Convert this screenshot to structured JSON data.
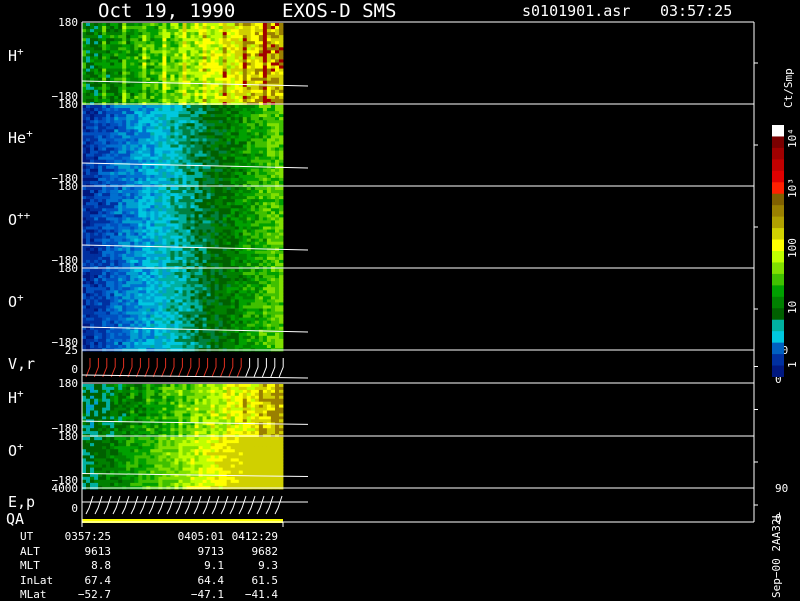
{
  "header": {
    "date": "Oct 19, 1990",
    "mission": "EXOS-D SMS",
    "file": "s0101901.asr",
    "time": "03:57:25"
  },
  "panels": [
    {
      "label": "H",
      "sup": "+",
      "ymax": "180",
      "ymin": "−180"
    },
    {
      "label": "He",
      "sup": "+",
      "ymax": "180",
      "ymin": "−180"
    },
    {
      "label": "O",
      "sup": "++",
      "ymax": "180",
      "ymin": "−180"
    },
    {
      "label": "O",
      "sup": "+",
      "ymax": "180",
      "ymin": "−180"
    },
    {
      "label": "V,r",
      "sup": "",
      "ymax": "25",
      "ymin": "0",
      "rmax": "90",
      "rmin": "0"
    },
    {
      "label": "H",
      "sup": "+",
      "ymax": "180",
      "ymin": "−180"
    },
    {
      "label": "O",
      "sup": "+",
      "ymax": "180",
      "ymin": "−180"
    },
    {
      "label": "E,p",
      "sup": "",
      "ymax": "4000",
      "ymin": "0",
      "rmax": "90",
      "rmin": "0"
    }
  ],
  "qa_label": "QA",
  "colorbar": {
    "unit": "Ct/Smp",
    "labels": [
      "10⁴",
      "10³",
      "100",
      "10",
      "1"
    ],
    "colors": [
      "#ffffff",
      "#7a0000",
      "#a00000",
      "#c00000",
      "#e00000",
      "#ff2000",
      "#806000",
      "#9a8000",
      "#b0a000",
      "#d0d000",
      "#ffff00",
      "#c0ff00",
      "#80e000",
      "#40c000",
      "#00a000",
      "#008000",
      "#006000",
      "#00b0a0",
      "#00c8e0",
      "#0060c0",
      "#0030a0",
      "#001880"
    ]
  },
  "footer_stamp": "Sep−00  2AA32L",
  "table": {
    "rows": [
      {
        "label": "UT",
        "values": [
          "0357:25",
          "0405:01",
          "0412:29"
        ]
      },
      {
        "label": "ALT",
        "values": [
          "9613",
          "9713",
          "9682"
        ]
      },
      {
        "label": "MLT",
        "values": [
          "8.8",
          "9.1",
          "9.3"
        ]
      },
      {
        "label": "InLat",
        "values": [
          "67.4",
          "64.4",
          "61.5"
        ]
      },
      {
        "label": "MLat",
        "values": [
          "−52.7",
          "−47.1",
          "−41.4"
        ]
      }
    ]
  },
  "chart_data": {
    "type": "heatmap",
    "title": "Oct 19, 1990   EXOS-D SMS",
    "x_times": [
      "0357:25",
      "0405:01",
      "0412:29"
    ],
    "colorbar_unit": "Ct/Smp",
    "colorbar_scale": "log",
    "colorbar_range": [
      1,
      10000
    ],
    "panels": [
      "H+",
      "He+",
      "O++",
      "O+",
      "V,r",
      "H+",
      "O+",
      "E,p"
    ],
    "ylim_angle": [
      -180,
      180
    ]
  }
}
